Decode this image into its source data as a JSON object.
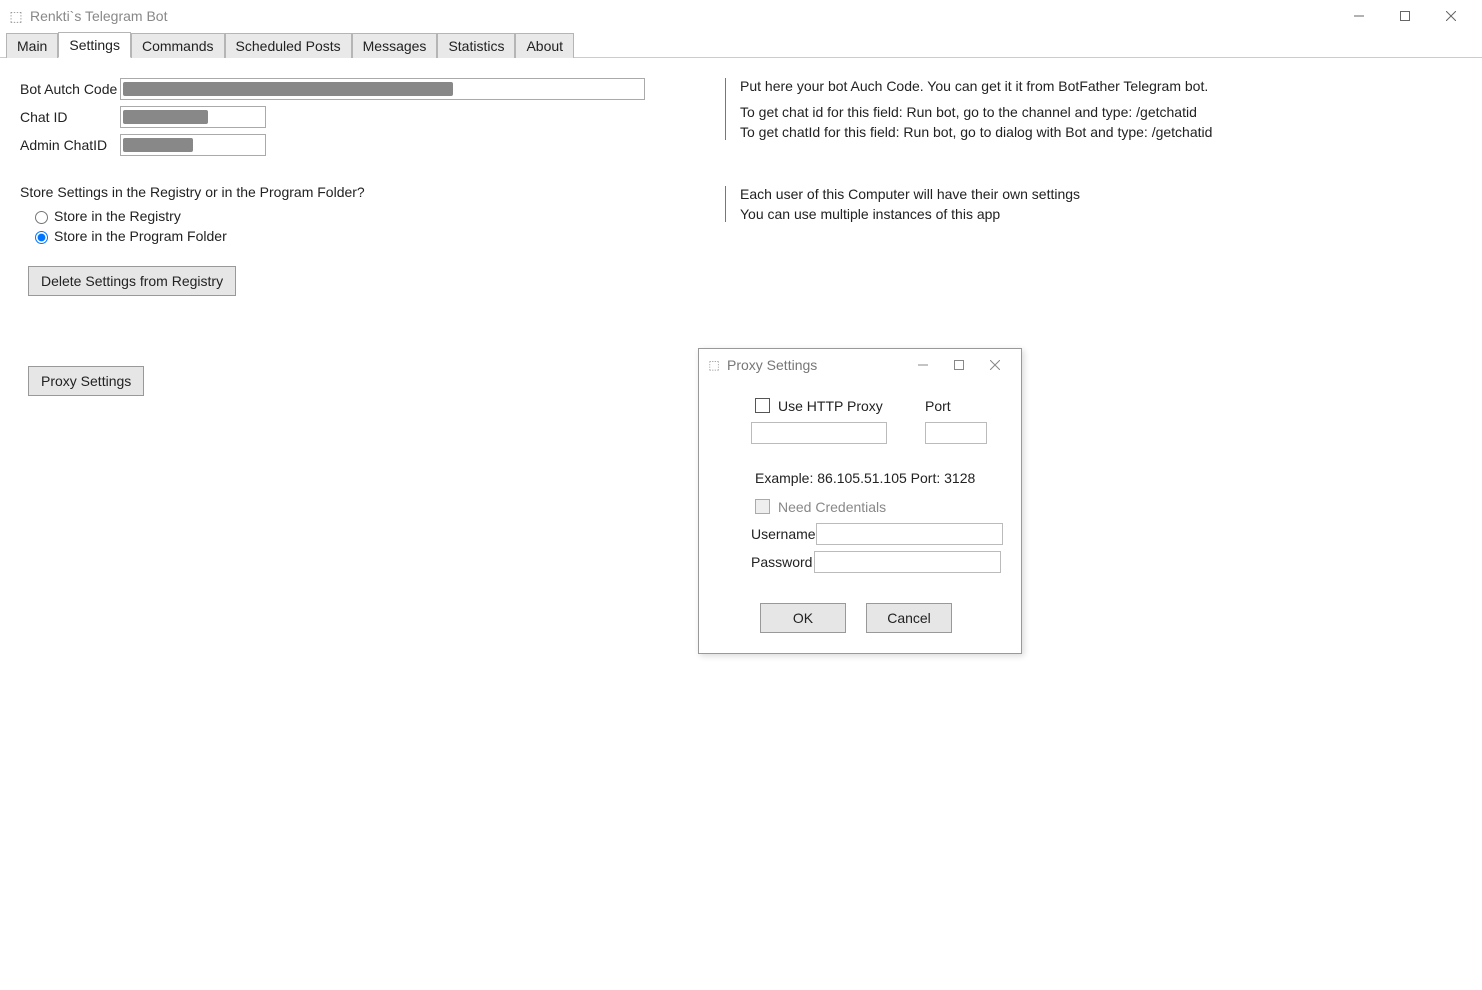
{
  "window": {
    "title": "Renkti`s Telegram Bot"
  },
  "tabs": [
    "Main",
    "Settings",
    "Commands",
    "Scheduled Posts",
    "Messages",
    "Statistics",
    "About"
  ],
  "active_tab": 1,
  "form": {
    "bot_auth_label": "Bot Autch Code",
    "chat_id_label": "Chat ID",
    "admin_chat_id_label": "Admin ChatID",
    "store_question": "Store Settings in the Registry or in the Program Folder?",
    "radio_registry": "Store in the Registry",
    "radio_folder": "Store in the Program Folder",
    "radio_selected": "folder",
    "delete_btn": "Delete Settings from Registry",
    "proxy_btn": "Proxy Settings"
  },
  "help": {
    "auth": "Put here your bot Auch Code. You can get it it from BotFather Telegram bot.",
    "chatid": "To get chat id for this field: Run bot, go to the channel and type: /getchatid",
    "adminid": "To get chatId for this field: Run bot, go to dialog with Bot and type: /getchatid",
    "reg1": "Each user of this Computer will have their own settings",
    "reg2": "You can use multiple instances of this app"
  },
  "dialog": {
    "title": "Proxy Settings",
    "use_http": "Use HTTP Proxy",
    "port_label": "Port",
    "host_value": "",
    "port_value": "",
    "example": "Example: 86.105.51.105  Port: 3128",
    "need_creds": "Need Credentials",
    "username_label": "Username",
    "password_label": "Password",
    "username_value": "",
    "password_value": "",
    "ok": "OK",
    "cancel": "Cancel"
  }
}
